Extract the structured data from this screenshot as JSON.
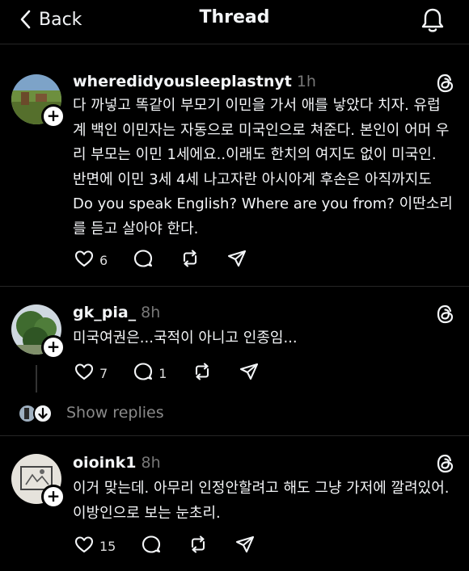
{
  "header": {
    "back_label": "Back",
    "title": "Thread"
  },
  "posts": [
    {
      "username": "wheredidyousleeplastnyt",
      "time": "1h",
      "text": "다 까넣고 똑같이 부모기 이민을 가서 애를 낳았다 치자. 유럽계 백인 이민자는 자동으로 미국인으로 쳐준다. 본인이 어머 우리 부모는 이민 1세에요..이래도 한치의 여지도 없이 미국인. 반면에 이민 3세 4세 나고자란 아시아계 후손은 아직까지도 Do you speak English? Where are you from? 이딴소리를 듣고 살아야 한다.",
      "likes": "6"
    },
    {
      "username": "gk_pia_",
      "time": "8h",
      "text": "미국여권은...국적이 아니고 인종임...",
      "likes": "7",
      "replies": "1"
    },
    {
      "username": "oioink1",
      "time": "8h",
      "text": "이거 맞는데. 아무리 인정안할려고 해도 그냥 가저에 깔려있어. 이방인으로 보는 눈초리.",
      "likes": "15"
    }
  ],
  "show_replies": "Show replies"
}
